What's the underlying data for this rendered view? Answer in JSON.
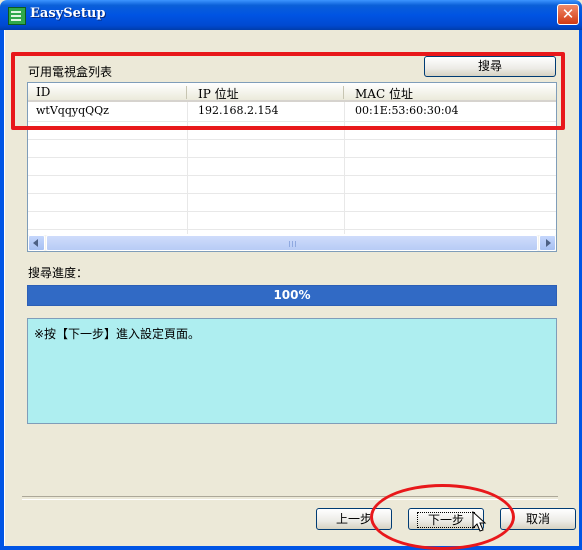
{
  "window": {
    "title": "EasySetup",
    "close_glyph": "✕"
  },
  "device_list": {
    "label": "可用電視盒列表",
    "search_button": "搜尋",
    "columns": [
      "ID",
      "IP 位址",
      "MAC 位址"
    ],
    "rows": [
      {
        "id": "wtVqqyqQQz",
        "ip": "192.168.2.154",
        "mac": "00:1E:53:60:30:04"
      }
    ],
    "scrollbar_grip_glyph": "|||"
  },
  "progress": {
    "label": "搜尋進度：",
    "percent": 100,
    "text": "100%"
  },
  "message": {
    "text": "※按【下一步】進入設定頁面。"
  },
  "buttons": {
    "back": "上一步",
    "next": "下一步",
    "cancel": "取消"
  },
  "colors": {
    "titlebar": "#0054e3",
    "progress": "#316ac5",
    "message_bg": "#aeeef0",
    "annotation": "#e8181b"
  },
  "icons": [
    "app-icon",
    "close-icon",
    "scroll-left-icon",
    "scroll-right-icon",
    "mouse-cursor-icon"
  ]
}
